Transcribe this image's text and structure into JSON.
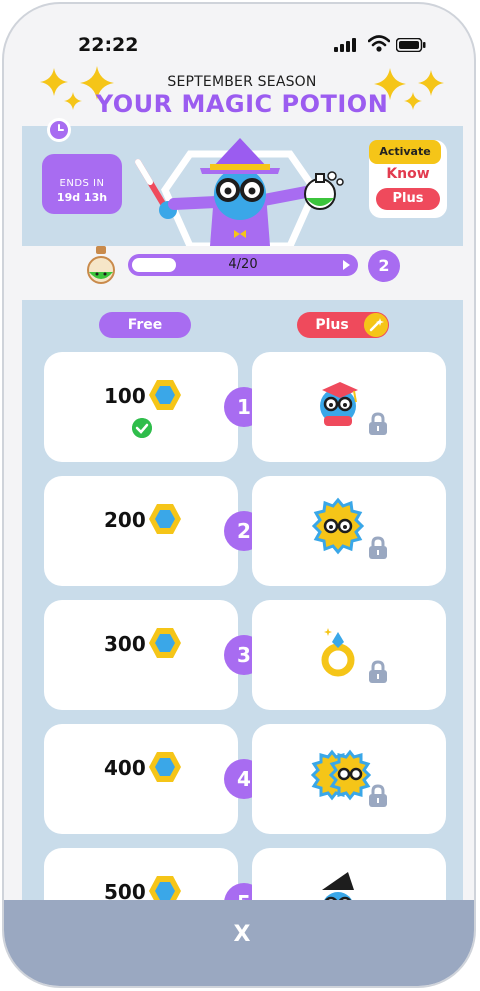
{
  "status_bar": {
    "time": "22:22"
  },
  "header": {
    "season": "SEPTEMBER SEASON",
    "title": "YOUR MAGIC POTION"
  },
  "banner": {
    "ends_label": "ENDS IN",
    "ends_value": "19d 13h",
    "activate_label": "Activate",
    "know_label": "Know",
    "plus_label": "Plus"
  },
  "progress": {
    "text": "4/20",
    "value": 0.2,
    "level": "2"
  },
  "columns": {
    "free": "Free",
    "plus": "Plus"
  },
  "rows": [
    {
      "level": "1",
      "amount": "100",
      "claimed": true,
      "reward": "wizard-grad-avatar"
    },
    {
      "level": "2",
      "amount": "200",
      "claimed": false,
      "reward": "sun-avatar"
    },
    {
      "level": "3",
      "amount": "300",
      "claimed": false,
      "reward": "magic-ring"
    },
    {
      "level": "4",
      "amount": "400",
      "claimed": false,
      "reward": "double-sun-avatar"
    },
    {
      "level": "5",
      "amount": "500",
      "claimed": false,
      "reward": "dark-hat-avatar"
    }
  ],
  "bottom": {
    "close_label": "X"
  },
  "colors": {
    "accent_purple": "#a86cf1",
    "title_purple": "#9b5cf0",
    "plus_red": "#ef4a5c",
    "gold": "#f5c518",
    "track_blue": "#c9dcea"
  }
}
